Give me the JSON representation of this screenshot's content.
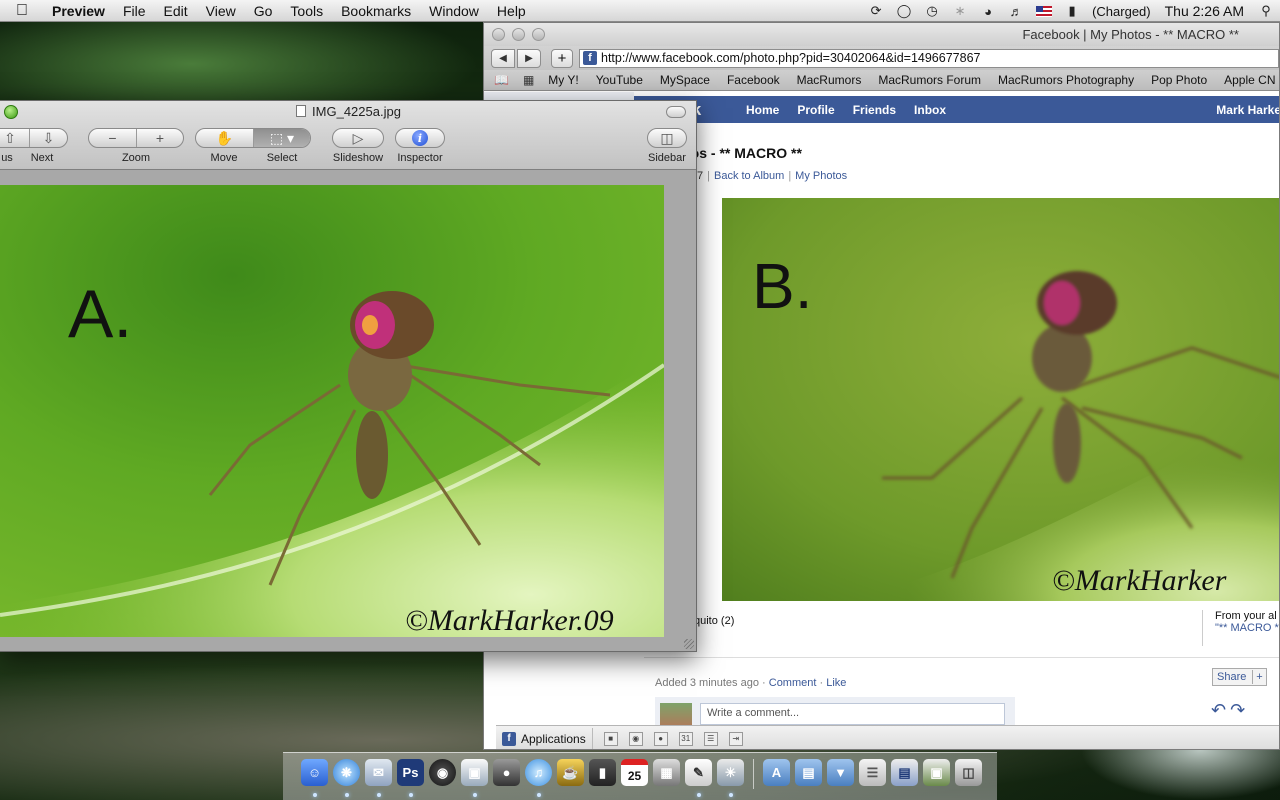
{
  "menubar": {
    "app": "Preview",
    "items": [
      "File",
      "Edit",
      "View",
      "Go",
      "Tools",
      "Bookmarks",
      "Window",
      "Help"
    ],
    "battery": "(Charged)",
    "clock": "Thu 2:26 AM"
  },
  "browser": {
    "title": "Facebook | My Photos - ** MACRO **",
    "url": "http://www.facebook.com/photo.php?pid=30402064&id=1496677867",
    "bookmarks": [
      "My Y!",
      "YouTube",
      "MySpace",
      "Facebook",
      "MacRumors",
      "MacRumors Forum",
      "MacRumors Photography",
      "Pop Photo",
      "Apple CN"
    ]
  },
  "facebook": {
    "logo": "ook",
    "nav": [
      "Home",
      "Profile",
      "Friends",
      "Inbox"
    ],
    "user": "Mark Harke",
    "album_title": "tos - ** MACRO **",
    "crumb_count": "7",
    "crumb_back": "Back to Album",
    "crumb_photos": "My Photos",
    "photo_label": "B.",
    "watermark": "©MarkHarker",
    "caption": "quito (2)",
    "from_label": "From your al",
    "from_link": "\"** MACRO *",
    "added": "Added 3 minutes ago · ",
    "comment_link": "Comment",
    "like_link": "Like",
    "share": "Share",
    "comment_placeholder": "Write a comment...",
    "applications": "Applications"
  },
  "preview": {
    "filename": "IMG_4225a.jpg",
    "labels": {
      "previous": "us",
      "next": "Next",
      "zoom": "Zoom",
      "move": "Move",
      "select": "Select",
      "slideshow": "Slideshow",
      "inspector": "Inspector",
      "sidebar": "Sidebar"
    },
    "photo_label": "A.",
    "watermark": "©MarkHarker.09"
  },
  "dock": {
    "icons": [
      "finder-icon",
      "safari-icon",
      "mail-icon",
      "photoshop-icon",
      "aperture-icon",
      "preview-icon",
      "camera-icon",
      "itunes-icon",
      "drink-icon",
      "unknown-app-icon",
      "ical-icon",
      "photo-booth-icon",
      "textedit-icon",
      "iphoto-icon",
      "applications-folder-icon",
      "documents-folder-icon",
      "downloads-folder-icon",
      "stack-icon",
      "photoshop-file-icon",
      "image-file-icon",
      "trash-icon"
    ],
    "ical_day": "25"
  },
  "colors": {
    "facebook_blue": "#3b5998",
    "leaf_green": "#7fbf2a"
  }
}
